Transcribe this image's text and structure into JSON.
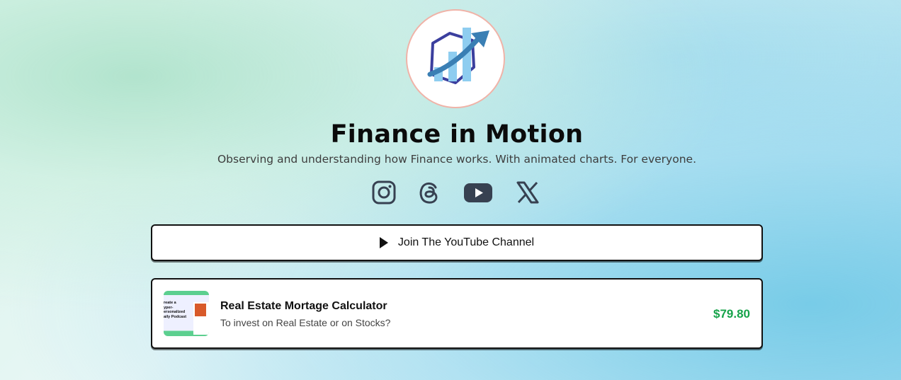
{
  "profile": {
    "logo_icon": "finance-chart-hexagon-logo",
    "title": "Finance in Motion",
    "subtitle": "Observing and understanding how Finance works. With animated charts. For everyone."
  },
  "socials": [
    {
      "icon": "instagram-icon"
    },
    {
      "icon": "threads-icon"
    },
    {
      "icon": "youtube-icon"
    },
    {
      "icon": "x-icon"
    }
  ],
  "links": {
    "youtube_button_label": "Join The YouTube Channel"
  },
  "product": {
    "title": "Real Estate Mortage Calculator",
    "subtitle": "To invest on Real Estate or on Stocks?",
    "price": "$79.80",
    "thumbnail_text": "reate a\nyper-\nersonalized\naily Podcast"
  },
  "colors": {
    "price": "#16a34a",
    "logo_border": "#f0b3a8",
    "logo_hexagon": "#3b3f9e",
    "logo_bars": "#8ecdf0",
    "logo_arrow": "#3a7fb4"
  }
}
